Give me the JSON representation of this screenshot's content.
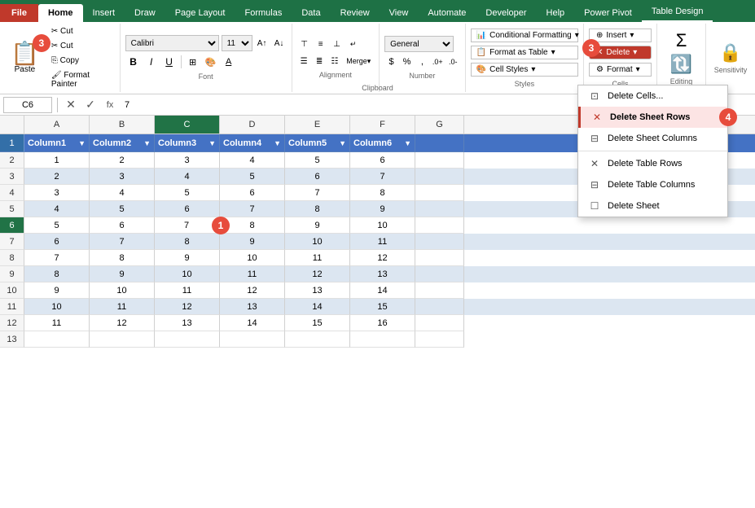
{
  "tabs": {
    "file": "File",
    "home": "Home",
    "insert": "Insert",
    "draw": "Draw",
    "page_layout": "Page Layout",
    "formulas": "Formulas",
    "data": "Data",
    "review": "Review",
    "view": "View",
    "automate": "Automate",
    "developer": "Developer",
    "help": "Help",
    "power_pivot": "Power Pivot",
    "table_design": "Table Design"
  },
  "ribbon": {
    "clipboard": {
      "label": "Clipboard",
      "paste": "Paste",
      "cut": "✂ Cut",
      "copy": "⎘ Copy",
      "format_painter": "🖌 Format Painter"
    },
    "font": {
      "label": "Font",
      "name": "Calibri",
      "size": "11",
      "bold": "B",
      "italic": "I",
      "underline": "U",
      "border": "⊞",
      "fill": "A",
      "color": "A"
    },
    "alignment": {
      "label": "Alignment"
    },
    "number": {
      "label": "Number",
      "format": "General"
    },
    "styles": {
      "label": "Styles",
      "conditional": "Conditional Formatting",
      "format_table": "Format as Table",
      "cell_styles": "Cell Styles"
    },
    "cells": {
      "label": "Cells",
      "insert": "Insert",
      "delete": "Delete",
      "format": "Format"
    },
    "editing": {
      "label": "Editing"
    },
    "sensitivity": {
      "label": "Sensitivity"
    }
  },
  "formula_bar": {
    "cell_ref": "C6",
    "value": "7"
  },
  "dropdown_menu": {
    "items": [
      {
        "id": "delete_cells",
        "icon": "⊡",
        "label": "Delete Cells..."
      },
      {
        "id": "delete_sheet_rows",
        "icon": "✕",
        "label": "Delete Sheet Rows",
        "highlighted": true
      },
      {
        "id": "delete_sheet_columns",
        "icon": "⊟",
        "label": "Delete Sheet Columns"
      },
      {
        "id": "delete_table_rows",
        "icon": "✕",
        "label": "Delete Table Rows"
      },
      {
        "id": "delete_table_columns",
        "icon": "⊟",
        "label": "Delete Table Columns"
      },
      {
        "id": "delete_sheet",
        "icon": "☐",
        "label": "Delete Sheet"
      }
    ]
  },
  "spreadsheet": {
    "columns": [
      "A",
      "B",
      "C",
      "D",
      "E",
      "F",
      "G"
    ],
    "headers": [
      "Column1",
      "Column2",
      "Column3",
      "Column4",
      "Column5",
      "Column6"
    ],
    "rows": [
      [
        1,
        2,
        3,
        4,
        5,
        6
      ],
      [
        2,
        3,
        4,
        5,
        6,
        7
      ],
      [
        3,
        4,
        5,
        6,
        7,
        8
      ],
      [
        4,
        5,
        6,
        7,
        8,
        9
      ],
      [
        5,
        6,
        7,
        8,
        9,
        10
      ],
      [
        6,
        7,
        8,
        9,
        10,
        11
      ],
      [
        7,
        8,
        9,
        10,
        11,
        12
      ],
      [
        8,
        9,
        10,
        11,
        12,
        13
      ],
      [
        9,
        10,
        11,
        12,
        13,
        14
      ],
      [
        10,
        11,
        12,
        13,
        14,
        15
      ],
      [
        11,
        12,
        13,
        14,
        15,
        16
      ]
    ],
    "active_cell": {
      "row": 6,
      "col": "C"
    }
  },
  "annotations": [
    {
      "id": 1,
      "label": "1",
      "color": "red"
    },
    {
      "id": 3,
      "label": "3",
      "color": "red"
    },
    {
      "id": 4,
      "label": "4",
      "color": "red"
    }
  ]
}
